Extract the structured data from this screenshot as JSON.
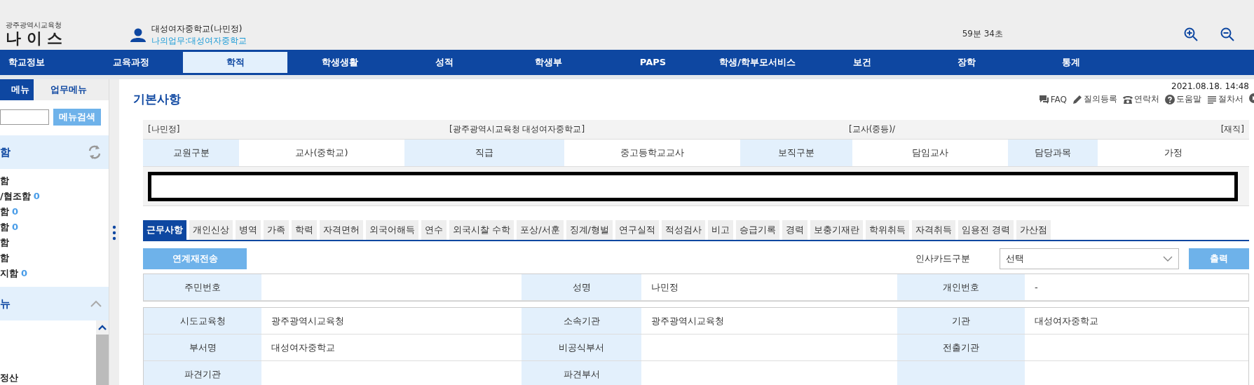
{
  "header": {
    "org": "광주광역시교육청",
    "logo": "나 이 스",
    "user_name": "대성여자중학교(나민정)",
    "user_work": "나의업무:대성여자중학교",
    "timer": "59분 34초"
  },
  "nav": [
    {
      "label": "학교정보",
      "selected": false
    },
    {
      "label": "교육과정",
      "selected": false
    },
    {
      "label": "학적",
      "selected": true
    },
    {
      "label": "학생생활",
      "selected": false
    },
    {
      "label": "성적",
      "selected": false
    },
    {
      "label": "학생부",
      "selected": false
    },
    {
      "label": "PAPS",
      "selected": false
    },
    {
      "label": "학생/학부모서비스",
      "selected": false
    },
    {
      "label": "보건",
      "selected": false
    },
    {
      "label": "장학",
      "selected": false
    },
    {
      "label": "통계",
      "selected": false
    }
  ],
  "sidebar": {
    "tabs": [
      {
        "label": "메뉴",
        "selected": true
      },
      {
        "label": "업무메뉴",
        "selected": false
      }
    ],
    "search_button": "메뉴검색",
    "inbox": {
      "title": "함",
      "items": [
        {
          "label": "함"
        },
        {
          "label": "/협조함",
          "count": "0"
        },
        {
          "label": "함",
          "count": "0"
        },
        {
          "label": "함",
          "count": "0"
        },
        {
          "label": "함"
        },
        {
          "label": "함"
        },
        {
          "label": "지함",
          "count": "0"
        }
      ]
    },
    "menu": {
      "title": "뉴",
      "items": [
        {
          "label": "정산"
        }
      ]
    }
  },
  "page": {
    "date": "2021.08.18. 14:48",
    "title": "기본사항",
    "links": [
      {
        "kind": "chat",
        "label": "FAQ"
      },
      {
        "kind": "pencil",
        "label": "질의등록"
      },
      {
        "kind": "phone",
        "label": "연락처"
      },
      {
        "kind": "help",
        "label": "도움말"
      },
      {
        "kind": "list",
        "label": "절차서"
      },
      {
        "kind": "play"
      }
    ]
  },
  "summary": [
    "[나민정]",
    "[광주광역시교육청 대성여자중학교]",
    "[교사(중등)/",
    "[재직]"
  ],
  "teacher_table": [
    {
      "label": "교원구분",
      "value": "교사(중학교)"
    },
    {
      "label": "직급",
      "value": "중고등학교교사"
    },
    {
      "label": "보직구분",
      "value": "담임교사"
    },
    {
      "label": "담당과목",
      "value": "가정"
    }
  ],
  "tabs": [
    {
      "label": "근무사항",
      "selected": true
    },
    {
      "label": "개인신상",
      "selected": false
    },
    {
      "label": "병역",
      "selected": false
    },
    {
      "label": "가족",
      "selected": false
    },
    {
      "label": "학력",
      "selected": false
    },
    {
      "label": "자격면허",
      "selected": false
    },
    {
      "label": "외국어해득",
      "selected": false
    },
    {
      "label": "연수",
      "selected": false
    },
    {
      "label": "외국시찰 수학",
      "selected": false
    },
    {
      "label": "포상/서훈",
      "selected": false
    },
    {
      "label": "징계/형벌",
      "selected": false
    },
    {
      "label": "연구실적",
      "selected": false
    },
    {
      "label": "적성검사",
      "selected": false
    },
    {
      "label": "비고",
      "selected": false
    },
    {
      "label": "승급기록",
      "selected": false
    },
    {
      "label": "경력",
      "selected": false
    },
    {
      "label": "보충기재란",
      "selected": false
    },
    {
      "label": "학위취득",
      "selected": false
    },
    {
      "label": "자격취득",
      "selected": false
    },
    {
      "label": "임용전 경력",
      "selected": false
    },
    {
      "label": "가산점",
      "selected": false
    }
  ],
  "actions": {
    "resend_button": "연계재전송",
    "card_type_label": "인사카드구분",
    "card_type_value": "선택",
    "print_button": "출력"
  },
  "person_table": [
    {
      "label": "주민번호"
    },
    {
      "label": "성명",
      "value": "나민정"
    },
    {
      "label": "개인번호",
      "value": "-"
    }
  ],
  "detail_table": [
    [
      {
        "label": "시도교육청",
        "value": "광주광역시교육청"
      },
      {
        "label": "소속기관",
        "value": "광주광역시교육청"
      },
      {
        "label": "기관",
        "value": "대성여자중학교"
      }
    ],
    [
      {
        "label": "부서명",
        "value": "대성여자중학교"
      },
      {
        "label": "비공식부서"
      },
      {
        "label": "전출기관"
      }
    ],
    [
      {
        "label": "파견기관"
      },
      {
        "label": "파견부서"
      }
    ]
  ]
}
